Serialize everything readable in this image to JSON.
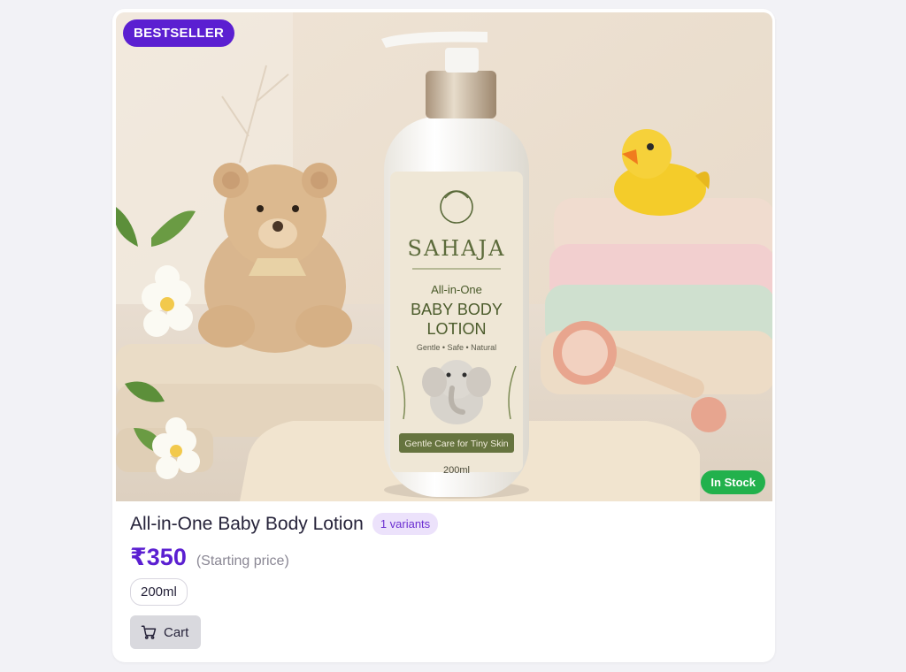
{
  "product": {
    "badge": "BESTSELLER",
    "stock_status": "In Stock",
    "title": "All-in-One Baby Body Lotion",
    "variants_badge": "1 variants",
    "price": "₹350",
    "price_note": "(Starting price)",
    "size_option": "200ml",
    "cart_label": "Cart"
  },
  "label": {
    "brand": "SAHAJA",
    "line1": "All-in-One",
    "line2": "BABY BODY",
    "line3": "LOTION",
    "tagline": "Gentle • Safe • Natural",
    "ribbon": "Gentle Care for Tiny Skin",
    "volume": "200ml"
  },
  "colors": {
    "accent": "#5b1fd1",
    "stock": "#22b14c",
    "variants_bg": "#ece2fb"
  }
}
